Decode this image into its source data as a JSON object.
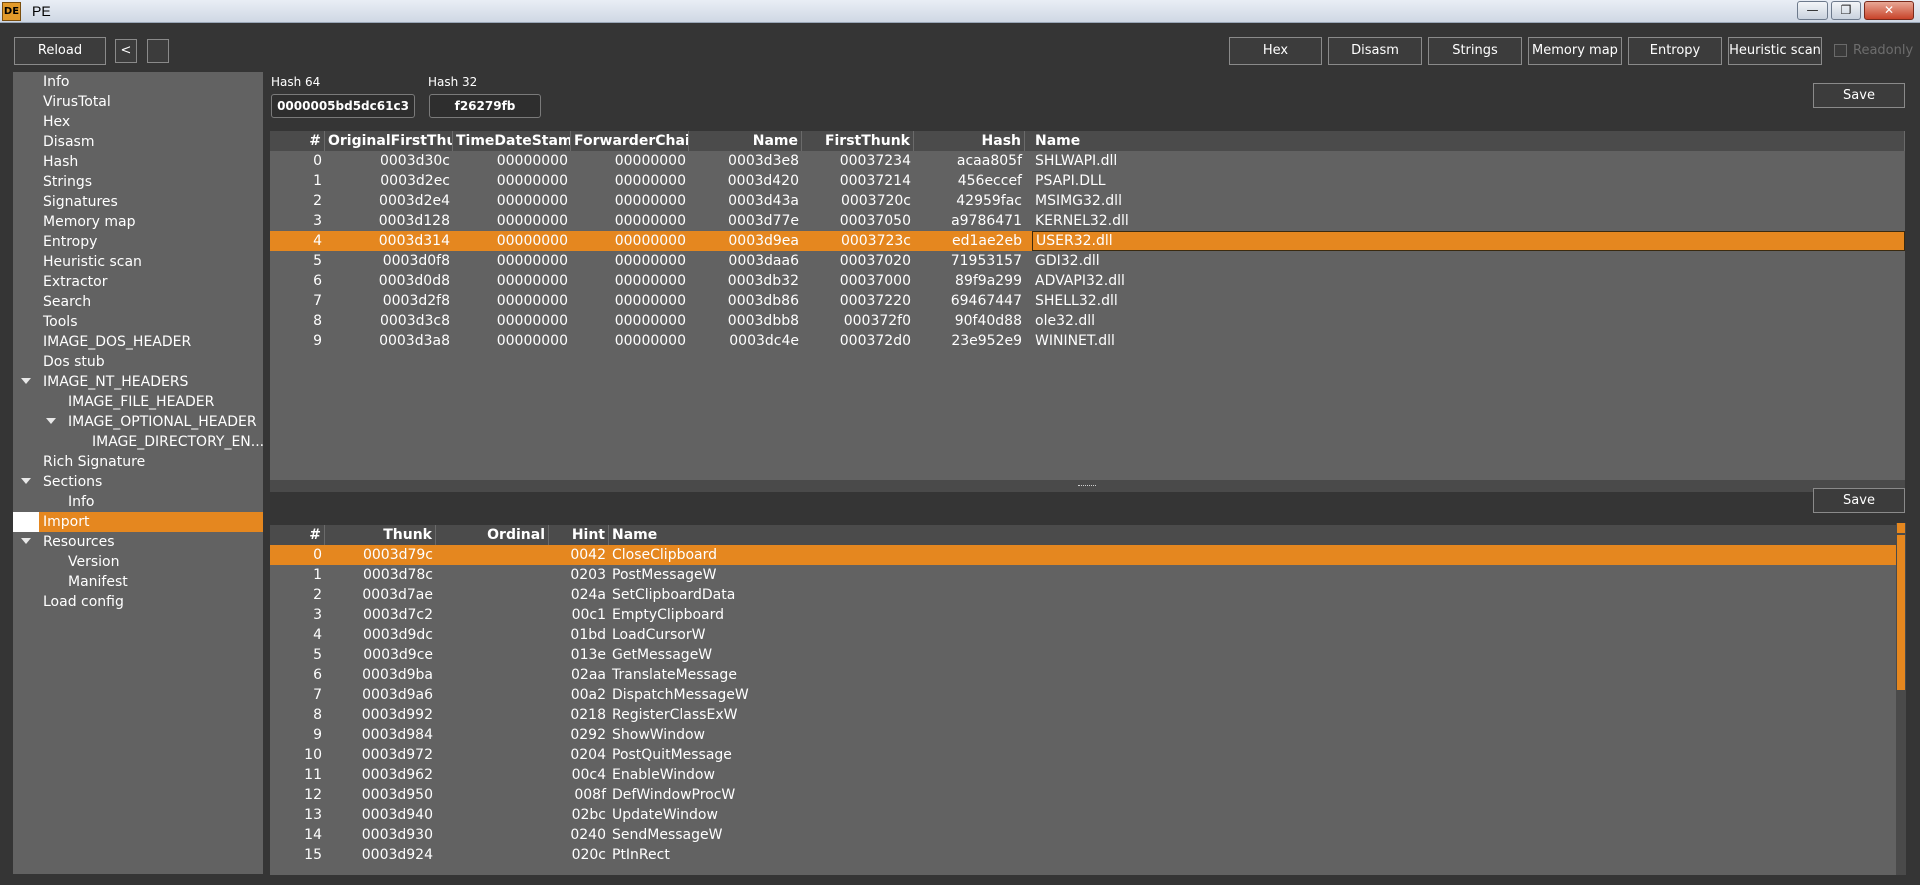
{
  "window": {
    "title": "PE",
    "icon_glyph": "DE",
    "minimize_glyph": "—",
    "restore_glyph": "❐",
    "close_glyph": "✕"
  },
  "toolbar": {
    "reload_label": "Reload",
    "back_label": "<",
    "forward_label": "",
    "buttons": [
      "Hex",
      "Disasm",
      "Strings",
      "Memory map",
      "Entropy",
      "Heuristic scan"
    ],
    "readonly_label": "Readonly"
  },
  "sidebar": {
    "items": [
      {
        "label": "Info",
        "level": 0
      },
      {
        "label": "VirusTotal",
        "level": 0
      },
      {
        "label": "Hex",
        "level": 0
      },
      {
        "label": "Disasm",
        "level": 0
      },
      {
        "label": "Hash",
        "level": 0
      },
      {
        "label": "Strings",
        "level": 0
      },
      {
        "label": "Signatures",
        "level": 0
      },
      {
        "label": "Memory map",
        "level": 0
      },
      {
        "label": "Entropy",
        "level": 0
      },
      {
        "label": "Heuristic scan",
        "level": 0
      },
      {
        "label": "Extractor",
        "level": 0
      },
      {
        "label": "Search",
        "level": 0
      },
      {
        "label": "Tools",
        "level": 0
      },
      {
        "label": "IMAGE_DOS_HEADER",
        "level": 0
      },
      {
        "label": "Dos stub",
        "level": 0
      },
      {
        "label": "IMAGE_NT_HEADERS",
        "level": 0,
        "expanded": true
      },
      {
        "label": "IMAGE_FILE_HEADER",
        "level": 1
      },
      {
        "label": "IMAGE_OPTIONAL_HEADER",
        "level": 1,
        "expanded": true
      },
      {
        "label": "IMAGE_DIRECTORY_EN...",
        "level": 2
      },
      {
        "label": "Rich Signature",
        "level": 0
      },
      {
        "label": "Sections",
        "level": 0,
        "expanded": true
      },
      {
        "label": "Info",
        "level": 1
      },
      {
        "label": "Import",
        "level": 0,
        "selected": true
      },
      {
        "label": "Resources",
        "level": 0,
        "expanded": true
      },
      {
        "label": "Version",
        "level": 1
      },
      {
        "label": "Manifest",
        "level": 1
      },
      {
        "label": "Load config",
        "level": 0
      }
    ]
  },
  "hash": {
    "hash64_label": "Hash 64",
    "hash64_value": "0000005bd5dc61c3",
    "hash32_label": "Hash 32",
    "hash32_value": "f26279fb"
  },
  "imports_table": {
    "save_label": "Save",
    "columns": [
      "#",
      "OriginalFirstThunk",
      "TimeDateStamp",
      "ForwarderChain",
      "Name",
      "FirstThunk",
      "Hash",
      "Name"
    ],
    "selected_index": 4,
    "rows": [
      [
        "0",
        "0003d30c",
        "00000000",
        "00000000",
        "0003d3e8",
        "00037234",
        "acaa805f",
        "SHLWAPI.dll"
      ],
      [
        "1",
        "0003d2ec",
        "00000000",
        "00000000",
        "0003d420",
        "00037214",
        "456eccef",
        "PSAPI.DLL"
      ],
      [
        "2",
        "0003d2e4",
        "00000000",
        "00000000",
        "0003d43a",
        "0003720c",
        "42959fac",
        "MSIMG32.dll"
      ],
      [
        "3",
        "0003d128",
        "00000000",
        "00000000",
        "0003d77e",
        "00037050",
        "a9786471",
        "KERNEL32.dll"
      ],
      [
        "4",
        "0003d314",
        "00000000",
        "00000000",
        "0003d9ea",
        "0003723c",
        "ed1ae2eb",
        "USER32.dll"
      ],
      [
        "5",
        "0003d0f8",
        "00000000",
        "00000000",
        "0003daa6",
        "00037020",
        "71953157",
        "GDI32.dll"
      ],
      [
        "6",
        "0003d0d8",
        "00000000",
        "00000000",
        "0003db32",
        "00037000",
        "89f9a299",
        "ADVAPI32.dll"
      ],
      [
        "7",
        "0003d2f8",
        "00000000",
        "00000000",
        "0003db86",
        "00037220",
        "69467447",
        "SHELL32.dll"
      ],
      [
        "8",
        "0003d3c8",
        "00000000",
        "00000000",
        "0003dbb8",
        "000372f0",
        "90f40d88",
        "ole32.dll"
      ],
      [
        "9",
        "0003d3a8",
        "00000000",
        "00000000",
        "0003dc4e",
        "000372d0",
        "23e952e9",
        "WININET.dll"
      ]
    ]
  },
  "functions_table": {
    "save_label": "Save",
    "columns": [
      "#",
      "Thunk",
      "Ordinal",
      "Hint",
      "Name"
    ],
    "selected_index": 0,
    "rows": [
      [
        "0",
        "0003d79c",
        "",
        "0042",
        "CloseClipboard"
      ],
      [
        "1",
        "0003d78c",
        "",
        "0203",
        "PostMessageW"
      ],
      [
        "2",
        "0003d7ae",
        "",
        "024a",
        "SetClipboardData"
      ],
      [
        "3",
        "0003d7c2",
        "",
        "00c1",
        "EmptyClipboard"
      ],
      [
        "4",
        "0003d9dc",
        "",
        "01bd",
        "LoadCursorW"
      ],
      [
        "5",
        "0003d9ce",
        "",
        "013e",
        "GetMessageW"
      ],
      [
        "6",
        "0003d9ba",
        "",
        "02aa",
        "TranslateMessage"
      ],
      [
        "7",
        "0003d9a6",
        "",
        "00a2",
        "DispatchMessageW"
      ],
      [
        "8",
        "0003d992",
        "",
        "0218",
        "RegisterClassExW"
      ],
      [
        "9",
        "0003d984",
        "",
        "0292",
        "ShowWindow"
      ],
      [
        "10",
        "0003d972",
        "",
        "0204",
        "PostQuitMessage"
      ],
      [
        "11",
        "0003d962",
        "",
        "00c4",
        "EnableWindow"
      ],
      [
        "12",
        "0003d950",
        "",
        "008f",
        "DefWindowProcW"
      ],
      [
        "13",
        "0003d940",
        "",
        "02bc",
        "UpdateWindow"
      ],
      [
        "14",
        "0003d930",
        "",
        "0240",
        "SendMessageW"
      ],
      [
        "15",
        "0003d924",
        "",
        "020c",
        "PtInRect"
      ]
    ]
  },
  "colors": {
    "accent": "#e5871f",
    "background": "#353535",
    "panel": "#626262"
  }
}
